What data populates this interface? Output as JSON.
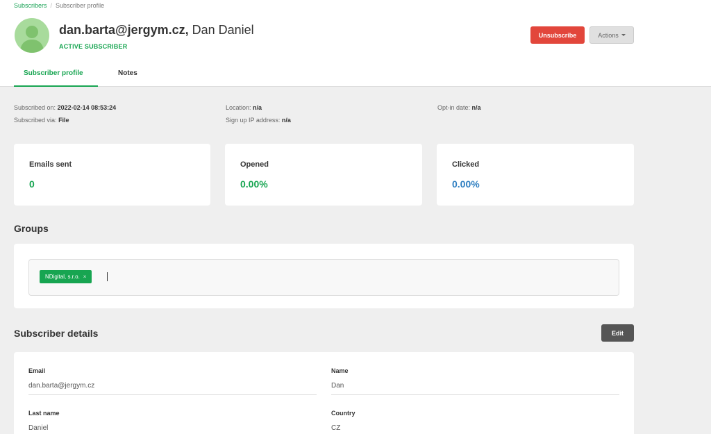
{
  "breadcrumb": {
    "parent": "Subscribers",
    "separator": "/",
    "current": "Subscriber profile"
  },
  "subscriber": {
    "email": "dan.barta@jergym.cz,",
    "name": "Dan Daniel",
    "status": "ACTIVE SUBSCRIBER"
  },
  "header_buttons": {
    "unsubscribe": "Unsubscribe",
    "actions": "Actions"
  },
  "tabs": [
    {
      "label": "Subscriber profile",
      "active": true
    },
    {
      "label": "Notes",
      "active": false
    }
  ],
  "meta": {
    "subscribed_on_label": "Subscribed on:",
    "subscribed_on": "2022-02-14 08:53:24",
    "subscribed_via_label": "Subscribed via:",
    "subscribed_via": "File",
    "location_label": "Location:",
    "location": "n/a",
    "signup_ip_label": "Sign up IP address:",
    "signup_ip": "n/a",
    "optin_label": "Opt-in date:",
    "optin": "n/a"
  },
  "stats": [
    {
      "label": "Emails sent",
      "value": "0",
      "color": "#17a551"
    },
    {
      "label": "Opened",
      "value": "0.00%",
      "color": "#17a551"
    },
    {
      "label": "Clicked",
      "value": "0.00%",
      "color": "#2f7fc1"
    }
  ],
  "groups": {
    "title": "Groups",
    "tags": [
      {
        "label": "NDigital, s.r.o.",
        "remove": "×"
      }
    ]
  },
  "details": {
    "title": "Subscriber details",
    "edit_label": "Edit",
    "fields": [
      {
        "label": "Email",
        "value": "dan.barta@jergym.cz"
      },
      {
        "label": "Name",
        "value": "Dan"
      },
      {
        "label": "Last name",
        "value": "Daniel"
      },
      {
        "label": "Country",
        "value": "CZ"
      }
    ]
  },
  "colors": {
    "accent": "#17a551",
    "danger": "#e2463b",
    "link_blue": "#2f7fc1"
  }
}
